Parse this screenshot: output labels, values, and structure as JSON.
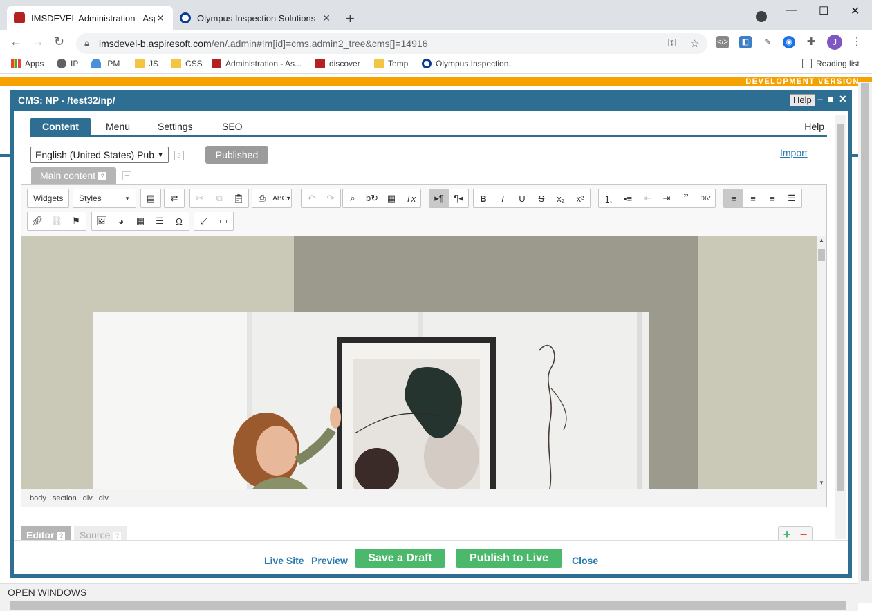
{
  "browser": {
    "tabs": [
      {
        "title": "IMSDEVEL Administration - Aspir",
        "close": "✕"
      },
      {
        "title": "Olympus Inspection Solutions—",
        "close": "✕"
      }
    ],
    "new_tab": "+",
    "address": {
      "host": "imsdevel-b.aspiresoft.com",
      "path": "/en/.admin#!m[id]=cms.admin2_tree&cms[]=14916"
    },
    "profile_initial": "J",
    "bookmarks": [
      "Apps",
      "IP",
      ".PM",
      "JS",
      "CSS",
      "Administration - As...",
      "discover",
      "Temp",
      "Olympus Inspection..."
    ],
    "reading_list": "Reading list"
  },
  "dev_banner": "DEVELOPMENT VERSION",
  "dialog": {
    "title": "CMS: NP - /test32/np/",
    "help_button": "Help",
    "tabs": [
      "Content",
      "Menu",
      "Settings",
      "SEO"
    ],
    "tabs_help": "Help",
    "language": "English (United States) Pub",
    "status": "Published",
    "import": "Import",
    "content_tab": "Main content",
    "editor": {
      "widgets": "Widgets",
      "styles": "Styles",
      "path": [
        "body",
        "section",
        "div",
        "div"
      ]
    },
    "mode_tabs": {
      "editor": "Editor",
      "source": "Source"
    },
    "footer": {
      "live_site": "Live Site",
      "preview": "Preview",
      "save_draft": "Save a Draft",
      "publish": "Publish to Live",
      "close": "Close"
    }
  },
  "open_windows": "OPEN WINDOWS",
  "colors": {
    "accent": "#2e6e92",
    "publish_green": "#4cb86c",
    "dev_orange": "#f5a200"
  }
}
